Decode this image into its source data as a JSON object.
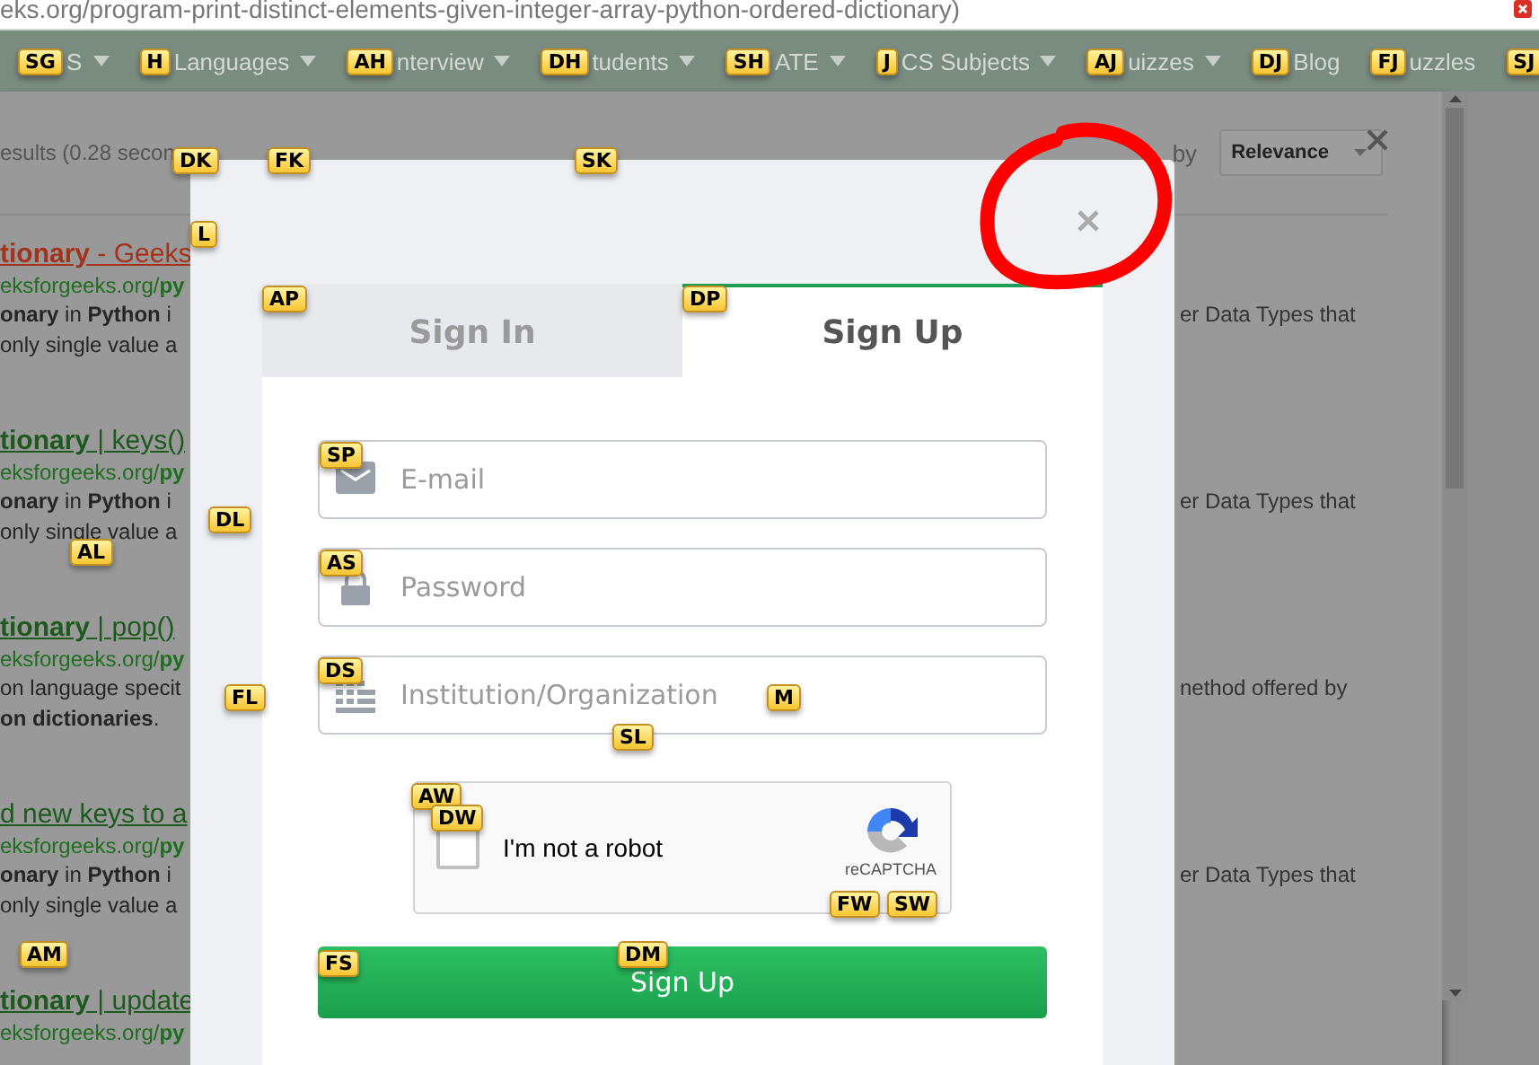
{
  "address_bar": {
    "url": "eks.org/program-print-distinct-elements-given-integer-array-python-ordered-dictionary)"
  },
  "nav": [
    {
      "hint": "SG",
      "label": "S",
      "menu": true
    },
    {
      "hint": "H",
      "label": "Languages",
      "menu": true
    },
    {
      "hint": "AH",
      "label": "nterview",
      "menu": true
    },
    {
      "hint": "DH",
      "label": "tudents",
      "menu": true
    },
    {
      "hint": "SH",
      "label": "ATE",
      "menu": true
    },
    {
      "hint": "J",
      "label": "CS Subjects",
      "menu": true
    },
    {
      "hint": "AJ",
      "label": "uizzes",
      "menu": true
    },
    {
      "hint": "DJ",
      "label": "Blog"
    },
    {
      "hint": "FJ",
      "label": "uzzles"
    },
    {
      "hint": "SJ"
    }
  ],
  "search_panel": {
    "results_count": "esults (0.28 secon",
    "sort_label": "by",
    "sort_value": "Relevance",
    "results": [
      {
        "title": "**tionary** - Geeks",
        "visited": true,
        "url": "eksforgeeks.org/**py**",
        "snippet": [
          {
            "left": "**onary** in **Python** i",
            "right": "er Data Types that"
          },
          {
            "left": "only single value a"
          }
        ]
      },
      {
        "title": "**tionary** | keys()",
        "visited": false,
        "url": "eksforgeeks.org/**py**",
        "snippet": [
          {
            "left": "**onary** in **Python** i",
            "right": "er Data Types that"
          },
          {
            "left": "only single value a"
          }
        ]
      },
      {
        "title": "**tionary** | pop()",
        "visited": false,
        "url": "eksforgeeks.org/**py**",
        "snippet": [
          {
            "left": "on language specit",
            "right": "nethod offered by"
          },
          {
            "left": "**on dictionaries**."
          }
        ]
      },
      {
        "title": "d new keys to a",
        "visited": false,
        "url": "eksforgeeks.org/**py**",
        "snippet": [
          {
            "left": "**onary** in **Python** i",
            "right": "er Data Types that"
          },
          {
            "left": "only single value a"
          }
        ]
      },
      {
        "title": "**tionary** | update",
        "visited": false,
        "url": "eksforgeeks.org/**py**"
      }
    ]
  },
  "modal": {
    "tabs": [
      {
        "label": "Sign In",
        "selected": false
      },
      {
        "label": "Sign Up",
        "selected": true
      }
    ],
    "fields": [
      {
        "kind": "email",
        "placeholder": "E-mail"
      },
      {
        "kind": "password",
        "placeholder": "Password"
      },
      {
        "kind": "organization",
        "placeholder": "Institution/Organization"
      }
    ],
    "captcha": {
      "label": "I'm not a robot",
      "checked": false,
      "brand": "reCAPTCHA"
    },
    "submit": "Sign Up"
  },
  "link_hints": [
    "DK",
    "FK",
    "SK",
    "L",
    "AP",
    "DP",
    "SP",
    "AL",
    "DL",
    "AS",
    "FL",
    "DS",
    "SL",
    "M",
    "AW",
    "DW",
    "FW",
    "SW",
    "AM",
    "FS",
    "DM"
  ]
}
